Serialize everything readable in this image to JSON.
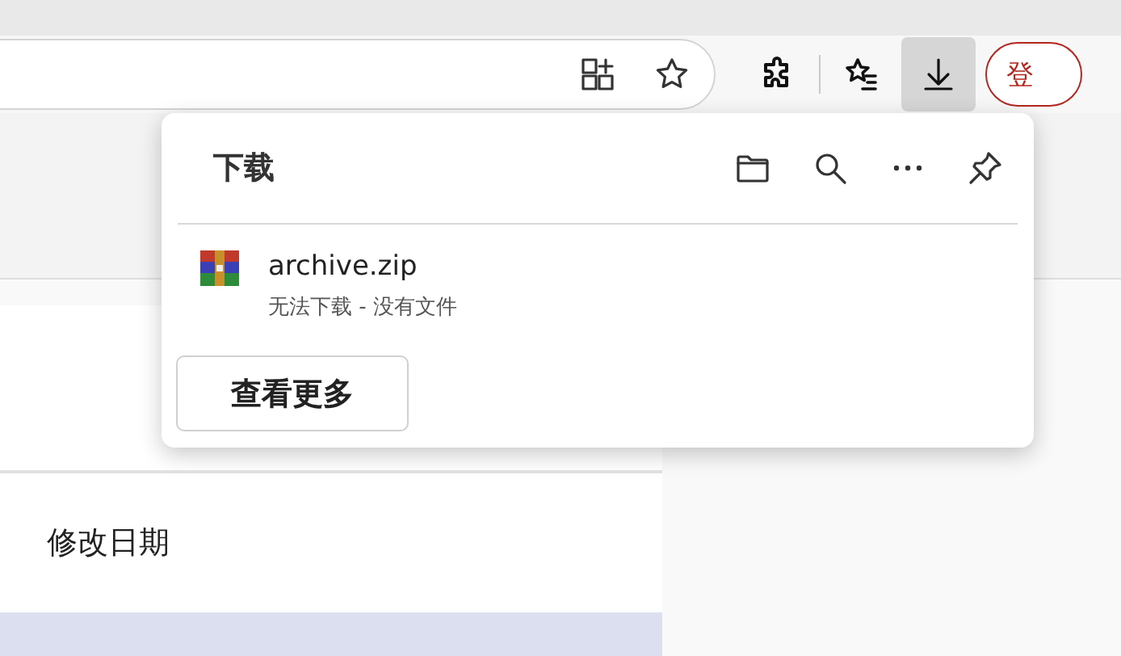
{
  "toolbar": {
    "sign_in": "登",
    "downloads_active": true
  },
  "downloads_panel": {
    "title": "下载",
    "items": [
      {
        "name": "archive.zip",
        "status": "无法下载 - 没有文件"
      }
    ],
    "more_button": "查看更多"
  },
  "table": {
    "column_header": "修改日期",
    "rows": [
      {
        "selected": true
      }
    ]
  }
}
